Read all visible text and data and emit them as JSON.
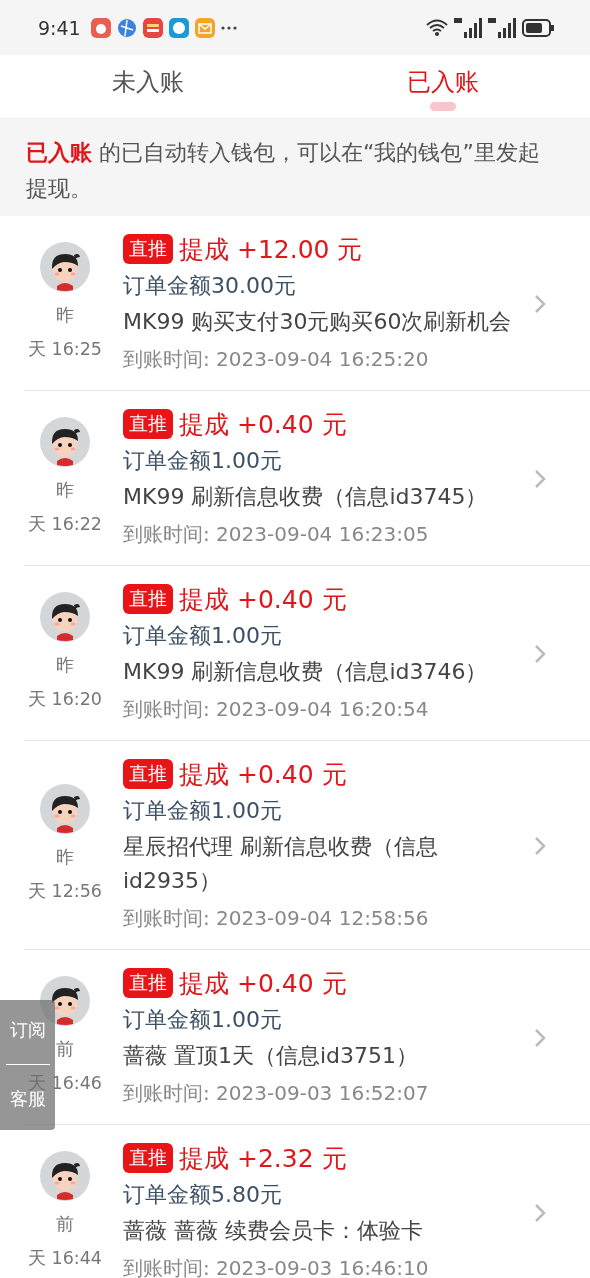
{
  "status_bar": {
    "time": "9:41"
  },
  "tabs": [
    {
      "label": "未入账",
      "selected": false
    },
    {
      "label": "已入账",
      "selected": true
    }
  ],
  "notice": {
    "text": "**已入账** 的已自动转入钱包，可以在“我的钱包”里发起提现。"
  },
  "records": [
    {
      "day_part": "昨",
      "time_part": "天 16:25",
      "badge": "直推",
      "title": "提成 +12.00 元",
      "order_amount": "订单金额30.00元",
      "description": "MK99 购买支付30元购买60次刷新机会",
      "arrival_time": "到账时间: 2023-09-04 16:25:20"
    },
    {
      "day_part": "昨",
      "time_part": "天 16:22",
      "badge": "直推",
      "title": "提成 +0.40 元",
      "order_amount": "订单金额1.00元",
      "description": "MK99 刷新信息收费（信息id3745）",
      "arrival_time": "到账时间: 2023-09-04 16:23:05"
    },
    {
      "day_part": "昨",
      "time_part": "天 16:20",
      "badge": "直推",
      "title": "提成 +0.40 元",
      "order_amount": "订单金额1.00元",
      "description": "MK99 刷新信息收费（信息id3746）",
      "arrival_time": "到账时间: 2023-09-04 16:20:54"
    },
    {
      "day_part": "昨",
      "time_part": "天 12:56",
      "badge": "直推",
      "title": "提成 +0.40 元",
      "order_amount": "订单金额1.00元",
      "description": "星辰招代理 刷新信息收费（信息id2935）",
      "arrival_time": "到账时间: 2023-09-04 12:58:56"
    },
    {
      "day_part": "前",
      "time_part": "天 16:46",
      "badge": "直推",
      "title": "提成 +0.40 元",
      "order_amount": "订单金额1.00元",
      "description": "蔷薇 置顶1天（信息id3751）",
      "arrival_time": "到账时间: 2023-09-03 16:52:07"
    },
    {
      "day_part": "前",
      "time_part": "天 16:44",
      "badge": "直推",
      "title": "提成 +2.32 元",
      "order_amount": "订单金额5.80元",
      "description": "蔷薇 蔷薇 续费会员卡：体验卡",
      "arrival_time": "到账时间: 2023-09-03 16:46:10"
    }
  ],
  "floating_panel": {
    "top_label": "订阅",
    "bottom_label": "客服"
  }
}
